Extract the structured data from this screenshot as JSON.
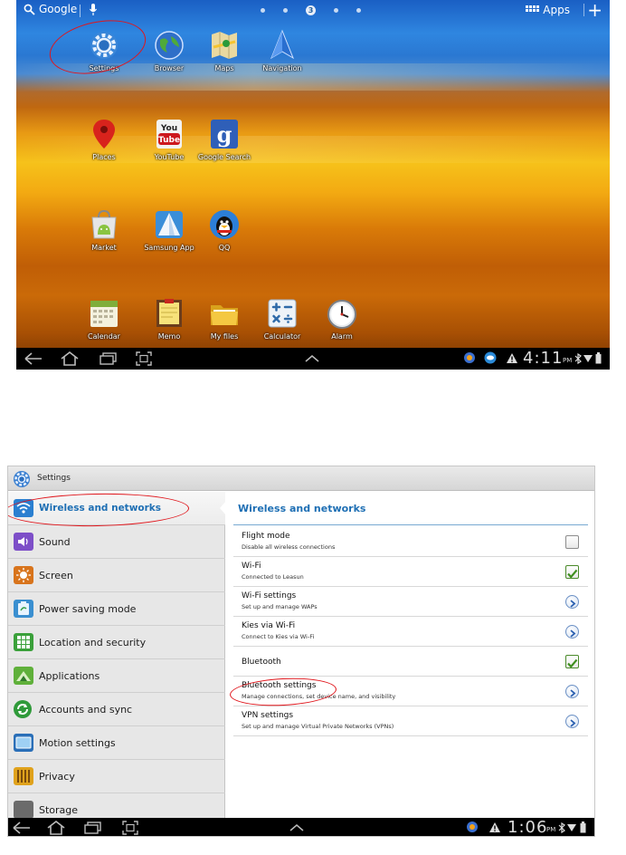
{
  "home": {
    "search_label": "Google",
    "page_indicator": "3",
    "apps_label": "Apps",
    "add_label": "+",
    "apps": [
      {
        "label": "Settings"
      },
      {
        "label": "Browser"
      },
      {
        "label": "Maps"
      },
      {
        "label": "Navigation"
      },
      {
        "label": "Places"
      },
      {
        "label": "YouTube"
      },
      {
        "label": "Google Search"
      },
      {
        "label": "Market"
      },
      {
        "label": "Samsung App"
      },
      {
        "label": "QQ"
      },
      {
        "label": "Calendar"
      },
      {
        "label": "Memo"
      },
      {
        "label": "My files"
      },
      {
        "label": "Calculator"
      },
      {
        "label": "Alarm"
      }
    ],
    "status": {
      "time": "4:11",
      "ampm": "PM"
    }
  },
  "settings": {
    "title": "Settings",
    "sidebar": [
      {
        "label": "Wireless and networks"
      },
      {
        "label": "Sound"
      },
      {
        "label": "Screen"
      },
      {
        "label": "Power saving mode"
      },
      {
        "label": "Location and security"
      },
      {
        "label": "Applications"
      },
      {
        "label": "Accounts and sync"
      },
      {
        "label": "Motion settings"
      },
      {
        "label": "Privacy"
      },
      {
        "label": "Storage"
      }
    ],
    "detail_header": "Wireless and networks",
    "rows": [
      {
        "title": "Flight mode",
        "sub": "Disable all wireless connections",
        "control": "checkbox",
        "checked": false
      },
      {
        "title": "Wi-Fi",
        "sub": "Connected to Leasun",
        "control": "checkbox",
        "checked": true
      },
      {
        "title": "Wi-Fi settings",
        "sub": "Set up and manage WAPs",
        "control": "arrow"
      },
      {
        "title": "Kies via Wi-Fi",
        "sub": "Connect to Kies via Wi-Fi",
        "control": "arrow"
      },
      {
        "title": "Bluetooth",
        "sub": "",
        "control": "checkbox",
        "checked": true
      },
      {
        "title": "Bluetooth settings",
        "sub": "Manage connections, set device name, and visibility",
        "control": "arrow"
      },
      {
        "title": "VPN settings",
        "sub": "Set up and manage Virtual Private Networks (VPNs)",
        "control": "arrow"
      }
    ],
    "status": {
      "time": "1:06",
      "ampm": "PM"
    }
  },
  "colors": {
    "accent_blue": "#1e6fb4",
    "annotation_red": "#e0161c",
    "check_green": "#3f8f1e"
  }
}
